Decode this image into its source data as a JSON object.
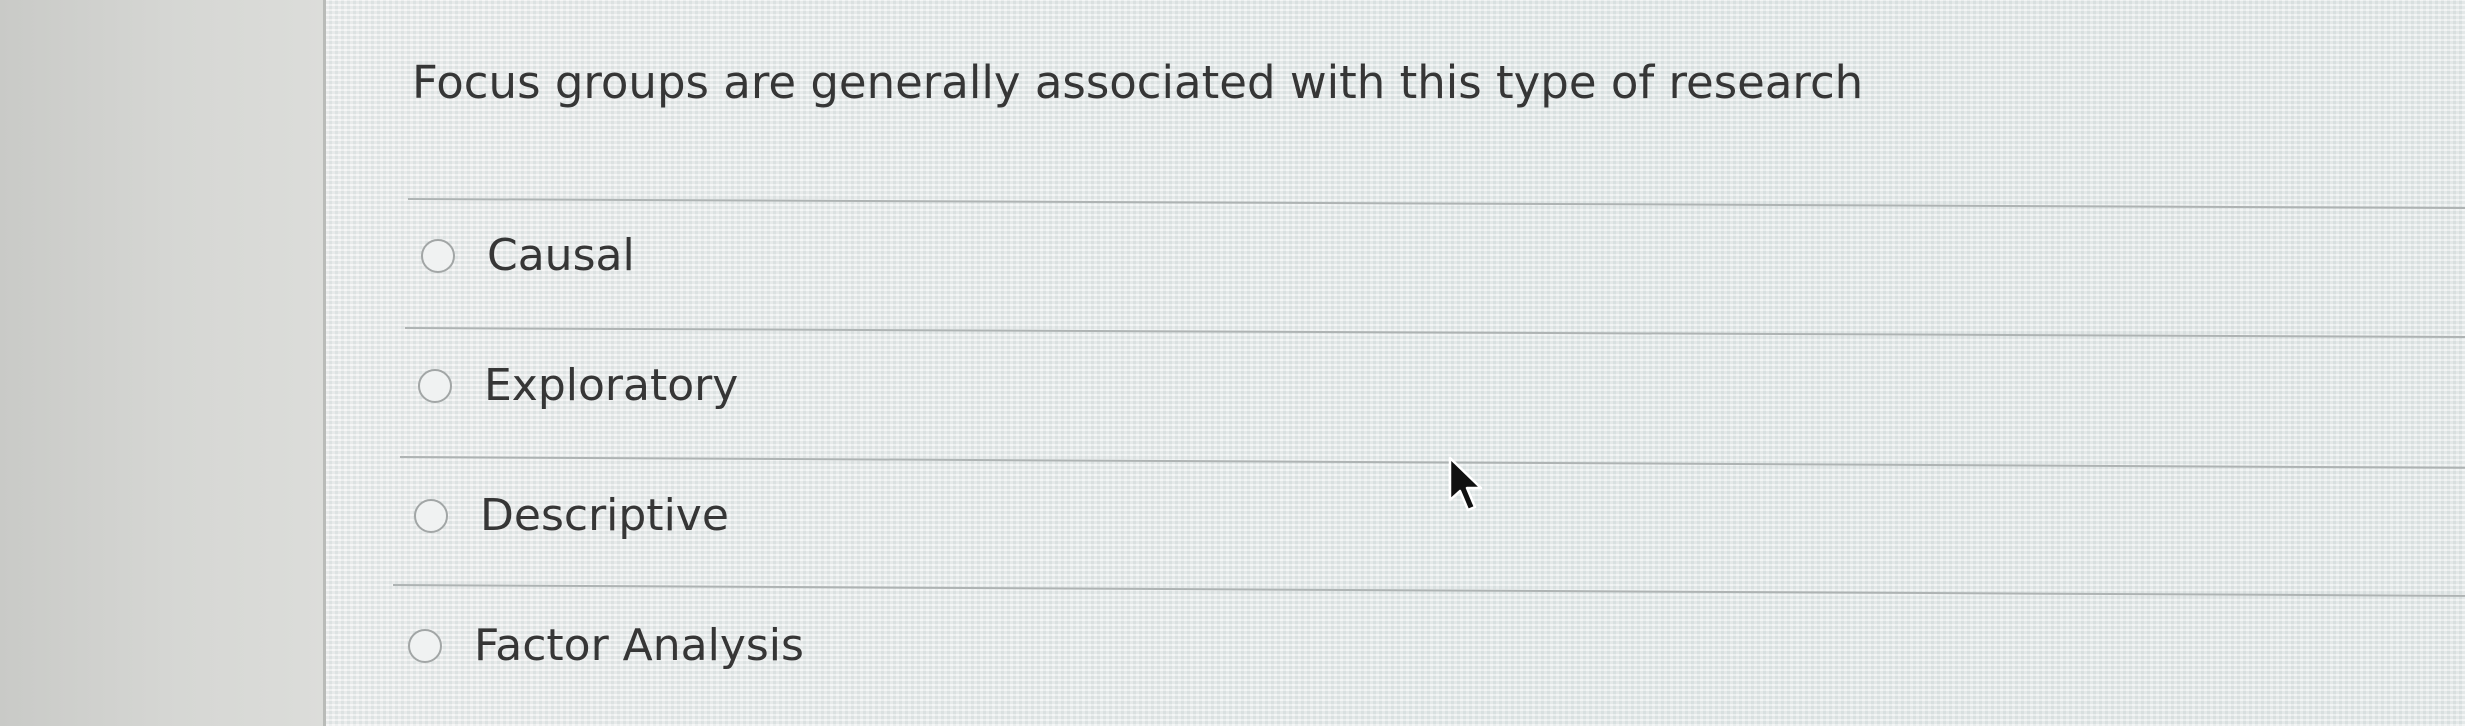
{
  "question": {
    "text": "Focus groups are generally associated with this type of research"
  },
  "options": [
    {
      "label": "Causal",
      "selected": false
    },
    {
      "label": "Exploratory",
      "selected": false
    },
    {
      "label": "Descriptive",
      "selected": false
    },
    {
      "label": "Factor Analysis",
      "selected": false
    }
  ],
  "cursor": {
    "icon": "arrow-pointer-icon"
  }
}
